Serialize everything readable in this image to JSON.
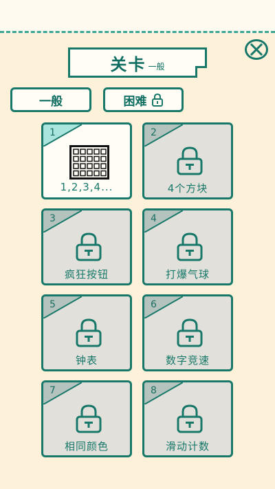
{
  "header": {
    "title": "关卡",
    "subtitle": "一般"
  },
  "tabs": [
    {
      "label": "一般",
      "locked": false
    },
    {
      "label": "困难",
      "locked": true
    }
  ],
  "levels": [
    {
      "number": "1",
      "name": "1,2,3,4...",
      "locked": false,
      "icon": "grid-icon"
    },
    {
      "number": "2",
      "name": "4个方块",
      "locked": true,
      "icon": "lock-icon"
    },
    {
      "number": "3",
      "name": "疯狂按钮",
      "locked": true,
      "icon": "lock-icon"
    },
    {
      "number": "4",
      "name": "打爆气球",
      "locked": true,
      "icon": "lock-icon"
    },
    {
      "number": "5",
      "name": "钟表",
      "locked": true,
      "icon": "lock-icon"
    },
    {
      "number": "6",
      "name": "数字竞速",
      "locked": true,
      "icon": "lock-icon"
    },
    {
      "number": "7",
      "name": "相同颜色",
      "locked": true,
      "icon": "lock-icon"
    },
    {
      "number": "8",
      "name": "滑动计数",
      "locked": true,
      "icon": "lock-icon"
    }
  ],
  "colors": {
    "accent": "#17786a",
    "background": "#fdf1da",
    "locked_card": "#e2e0da",
    "corner_unlocked": "#a9e4dd",
    "corner_locked": "#b4c3bd"
  }
}
